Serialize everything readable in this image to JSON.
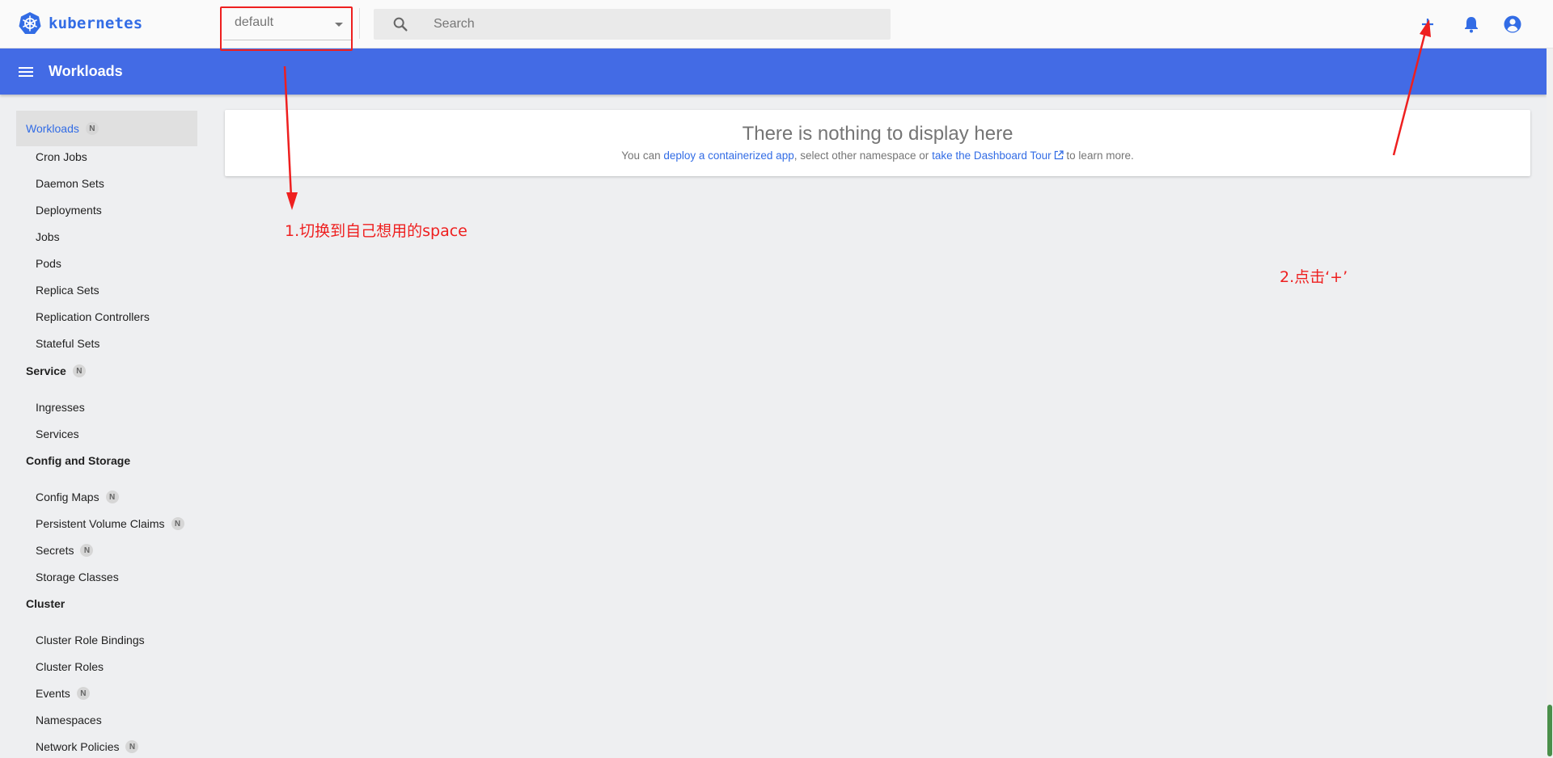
{
  "brand": {
    "name": "kubernetes"
  },
  "toolbar": {
    "namespace_value": "default",
    "search_placeholder": "Search",
    "add_icon": "add-icon",
    "notifications_icon": "bell-icon",
    "account_icon": "account-circle-icon"
  },
  "titlebar": {
    "title": "Workloads"
  },
  "sidebar": {
    "workloads": {
      "label": "Workloads",
      "badge": "N"
    },
    "workload_items": [
      "Cron Jobs",
      "Daemon Sets",
      "Deployments",
      "Jobs",
      "Pods",
      "Replica Sets",
      "Replication Controllers",
      "Stateful Sets"
    ],
    "service": {
      "label": "Service",
      "badge": "N"
    },
    "service_items": [
      "Ingresses",
      "Services"
    ],
    "config": {
      "label": "Config and Storage"
    },
    "config_items": [
      {
        "label": "Config Maps",
        "badge": "N"
      },
      {
        "label": "Persistent Volume Claims",
        "badge": "N"
      },
      {
        "label": "Secrets",
        "badge": "N"
      },
      {
        "label": "Storage Classes",
        "badge": ""
      }
    ],
    "cluster": {
      "label": "Cluster"
    },
    "cluster_items": [
      {
        "label": "Cluster Role Bindings",
        "badge": ""
      },
      {
        "label": "Cluster Roles",
        "badge": ""
      },
      {
        "label": "Events",
        "badge": "N"
      },
      {
        "label": "Namespaces",
        "badge": ""
      },
      {
        "label": "Network Policies",
        "badge": "N"
      }
    ]
  },
  "empty_state": {
    "title": "There is nothing to display here",
    "text_1": "You can ",
    "link_1": "deploy a containerized app",
    "text_2": ", select other namespace or ",
    "link_2": "take the Dashboard Tour",
    "text_3": " to learn more."
  },
  "annotations": {
    "note_1": "1.切换到自己想用的space",
    "note_2": "2.点击‘+’",
    "color": "#ee1f1f"
  },
  "colors": {
    "accent": "#326ce5",
    "titlebar": "#436be5"
  }
}
